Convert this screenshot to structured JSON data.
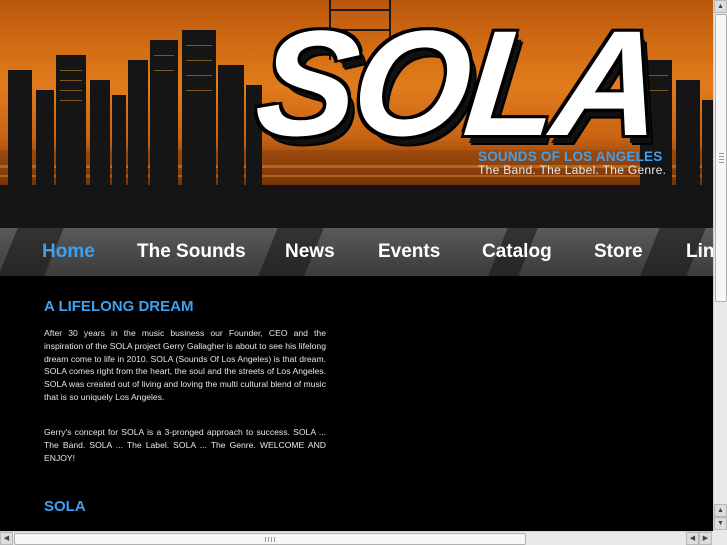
{
  "header": {
    "logo_text": "SOLA",
    "tagline_primary": "SOUNDS OF LOS ANGELES",
    "tagline_secondary": "The Band. The Label. The Genre."
  },
  "nav": {
    "items": [
      {
        "label": "Home",
        "active": true
      },
      {
        "label": "The Sounds",
        "active": false
      },
      {
        "label": "News",
        "active": false
      },
      {
        "label": "Events",
        "active": false
      },
      {
        "label": "Catalog",
        "active": false
      },
      {
        "label": "Store",
        "active": false
      },
      {
        "label": "Lin",
        "active": false
      }
    ]
  },
  "main": {
    "heading1": "A LIFELONG DREAM",
    "paragraph1": "After 30 years in the music business our Founder, CEO and the inspiration of the SOLA project Gerry Gallagher is about to see his lifelong dream come to life in 2010. SOLA (Sounds Of Los Angeles) is that dream. SOLA comes right from the heart, the soul and the streets of Los Angeles. SOLA was created out of living and loving the multi cultural blend of music that is so uniquely Los Angeles.",
    "paragraph2": "Gerry's concept for SOLA is a 3-pronged approach to success. SOLA ... The Band. SOLA ... The Label. SOLA ... The Genre. WELCOME AND ENJOY!",
    "heading2": "SOLA"
  },
  "colors": {
    "accent": "#3fa0f0",
    "nav_bg": "#4a4a4a",
    "page_bg": "#000000",
    "sky_orange": "#e07c1c"
  },
  "icons": {
    "scroll_up": "arrow-up-icon",
    "scroll_down": "arrow-down-icon",
    "scroll_left": "arrow-left-icon",
    "scroll_right": "arrow-right-icon"
  }
}
